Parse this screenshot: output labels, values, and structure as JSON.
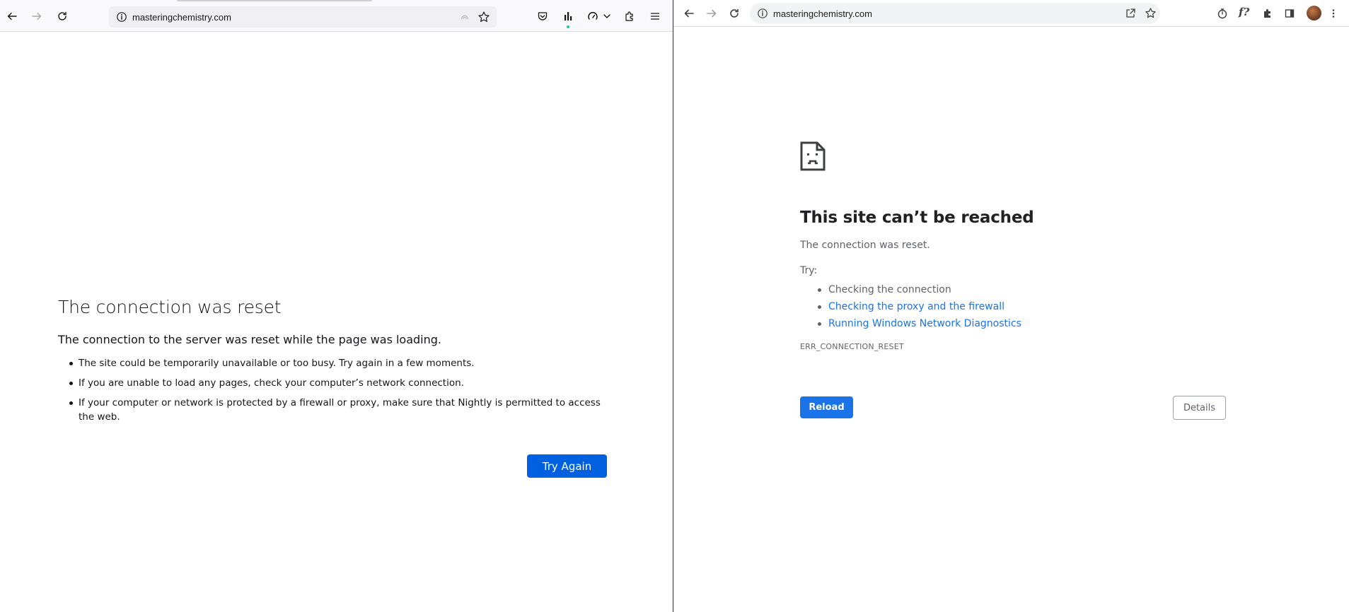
{
  "firefox": {
    "url": "masteringchemistry.com",
    "error_title": "The connection was reset",
    "error_description": "The connection to the server was reset while the page was loading.",
    "suggestions": [
      "The site could be temporarily unavailable or too busy. Try again in a few moments.",
      "If you are unable to load any pages, check your computer’s network connection.",
      "If your computer or network is protected by a firewall or proxy, make sure that Nightly is permitted to access the web."
    ],
    "try_again_label": "Try Again",
    "colors": {
      "accent": "#0061e0",
      "toolbar_bg": "#f9f9fb"
    }
  },
  "chrome": {
    "url": "masteringchemistry.com",
    "error_title": "This site can’t be reached",
    "error_description": "The connection was reset.",
    "try_label": "Try:",
    "suggestions": [
      {
        "text": "Checking the connection",
        "link": false
      },
      {
        "text": "Checking the proxy and the firewall",
        "link": true
      },
      {
        "text": "Running Windows Network Diagnostics",
        "link": true
      }
    ],
    "error_code": "ERR_CONNECTION_RESET",
    "reload_label": "Reload",
    "details_label": "Details",
    "extension_label": "f?",
    "colors": {
      "accent": "#1a73e8",
      "link": "#1a73e8",
      "text_secondary": "#5f6368"
    }
  }
}
